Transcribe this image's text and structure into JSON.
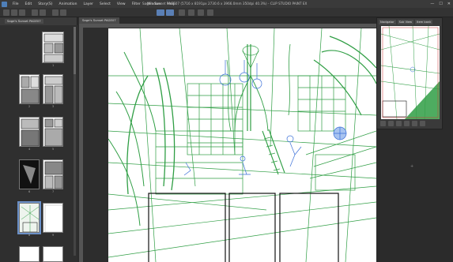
{
  "menu": {
    "items": [
      "File",
      "Edit",
      "Story(S)",
      "Animation",
      "Layer",
      "Select",
      "View",
      "Filter",
      "Window",
      "Help"
    ]
  },
  "window": {
    "title": "Sage's Sunset PAGE07 (5716 x 8191px 2730.6 x 3966.0mm 350dpi 40.3%) - CLIP STUDIO PAINT EX",
    "minimize": "—",
    "maximize": "☐",
    "close": "✕"
  },
  "page_manager": {
    "tab_label": "Sage's Sunset PAGE07",
    "pages": [
      {
        "number": "1"
      },
      {
        "number": "2"
      },
      {
        "number": "3"
      },
      {
        "number": "4"
      },
      {
        "number": "5"
      },
      {
        "number": "6"
      },
      {
        "number": "7"
      },
      {
        "number": "8"
      },
      {
        "number": "9"
      }
    ]
  },
  "document": {
    "tab_label": "Sage's Sunset PAGE07"
  },
  "navigator": {
    "tabs": [
      "Navigator",
      "Sub View",
      "Item bank"
    ]
  },
  "colors": {
    "sketch_green": "#2f9e44",
    "sketch_blue": "#3a6fd8",
    "panel_ink": "#111111",
    "accent": "#5a7fb5"
  }
}
